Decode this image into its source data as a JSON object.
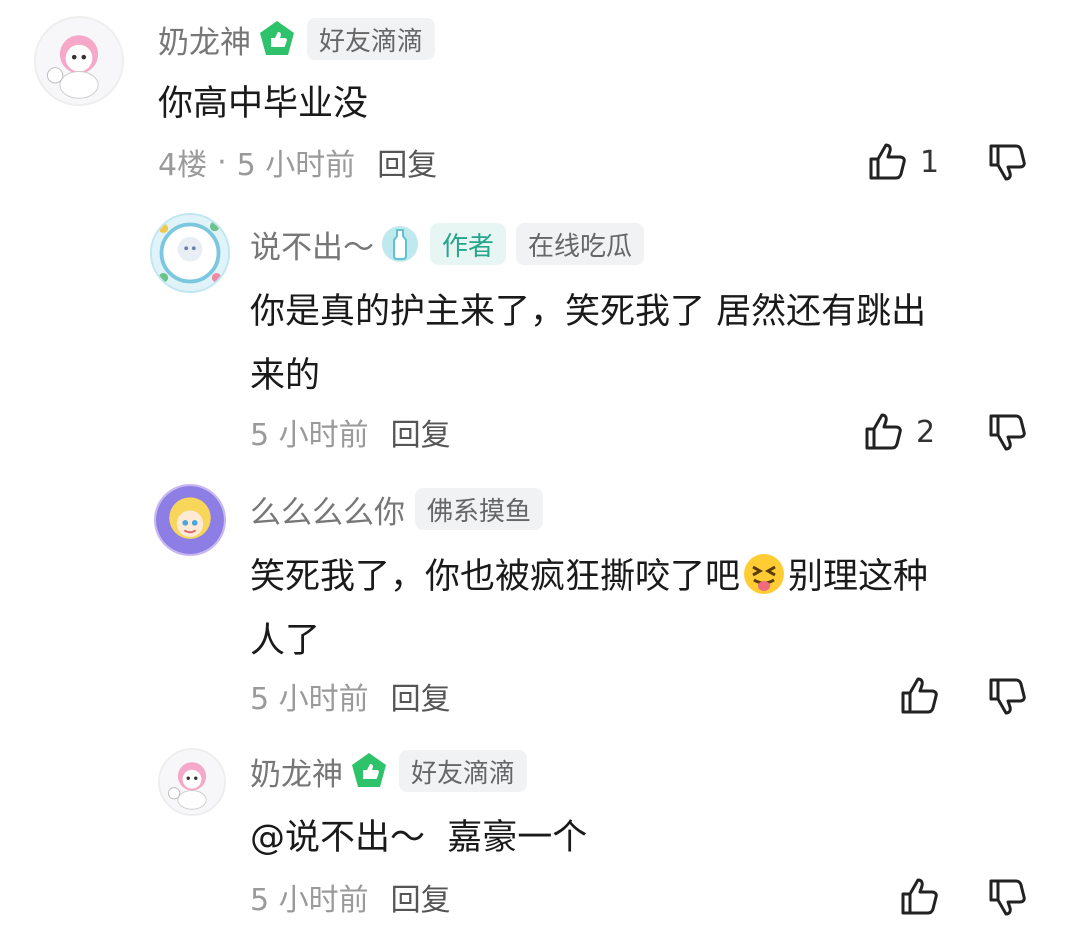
{
  "colors": {
    "author_tag": "#25a58a",
    "level_badge": "#2ec36b",
    "meta": "#9a9a9a"
  },
  "comments": [
    {
      "username": "奶龙神",
      "level_icon": "thumb-badge-icon",
      "tags": [
        "好友滴滴"
      ],
      "content": "你高中毕业没",
      "floor": "4楼",
      "separator": "·",
      "time": "5 小时前",
      "reply_label": "回复",
      "likes": "1"
    },
    {
      "username": "说不出～",
      "level_icon": "bottle-badge-icon",
      "author_tag": "作者",
      "tags": [
        "在线吃瓜"
      ],
      "content_line1": "你是真的护主来了，笑死我了 居然还有跳出",
      "content_line2": "来的",
      "time": "5 小时前",
      "reply_label": "回复",
      "likes": "2"
    },
    {
      "username": "么么么么你",
      "tags": [
        "佛系摸鱼"
      ],
      "content_part1": "笑死我了，你也被疯狂撕咬了吧",
      "emoji": "squinting-tongue-emoji",
      "content_part2": "别理这种",
      "content_line2": "人了",
      "time": "5 小时前",
      "reply_label": "回复"
    },
    {
      "username": "奶龙神",
      "level_icon": "thumb-badge-icon",
      "tags": [
        "好友滴滴"
      ],
      "content": "@说不出～  嘉豪一个",
      "time": "5 小时前",
      "reply_label": "回复"
    }
  ]
}
